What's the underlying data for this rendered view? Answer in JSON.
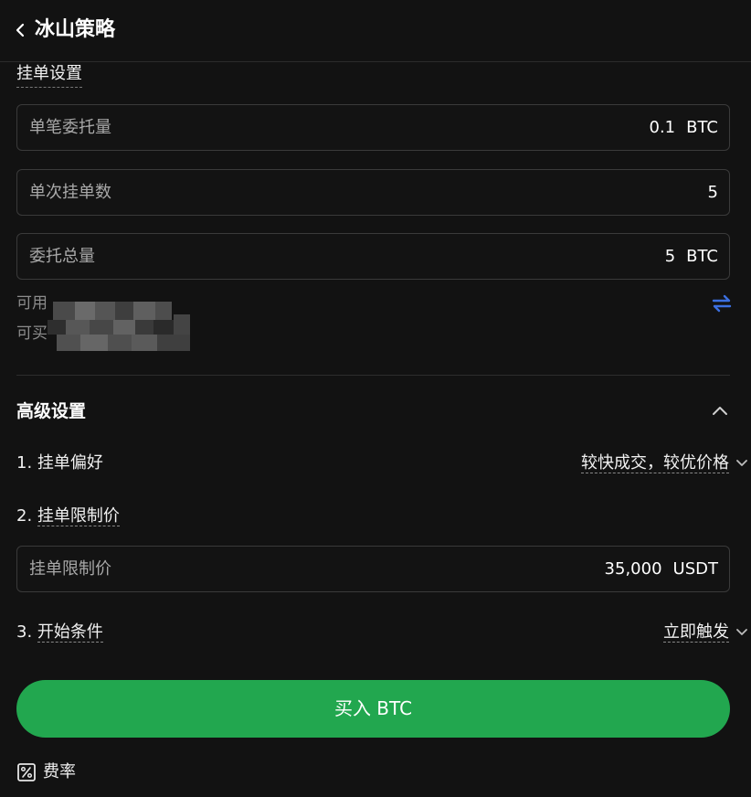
{
  "header": {
    "title": "冰山策略"
  },
  "order_settings": {
    "title": "挂单设置",
    "fields": [
      {
        "label": "单笔委托量",
        "value": "0.1",
        "unit": "BTC"
      },
      {
        "label": "单次挂单数",
        "value": "5",
        "unit": ""
      },
      {
        "label": "委托总量",
        "value": "5",
        "unit": "BTC"
      }
    ],
    "available_label": "可用",
    "buyable_label": "可买"
  },
  "advanced": {
    "title": "高级设置",
    "preference": {
      "number": "1.",
      "label": "挂单偏好",
      "value": "较快成交，较优价格"
    },
    "limit_price": {
      "number": "2.",
      "label": "挂单限制价",
      "field_label": "挂单限制价",
      "value": "35,000",
      "unit": "USDT"
    },
    "start_condition": {
      "number": "3.",
      "label": "开始条件",
      "value": "立即触发"
    }
  },
  "buy_button": {
    "label": "买入 BTC"
  },
  "fee": {
    "label": "费率"
  },
  "colors": {
    "background": "#121212",
    "accent_green": "#22a74f",
    "swap_icon_blue": "#3b6fe0",
    "muted_text": "#a8a8a8"
  },
  "icons": {
    "back": "chevron-left-icon",
    "swap": "swap-arrows-icon",
    "collapse": "chevron-up-icon",
    "expand": "chevron-down-icon",
    "fee": "percent-icon"
  }
}
